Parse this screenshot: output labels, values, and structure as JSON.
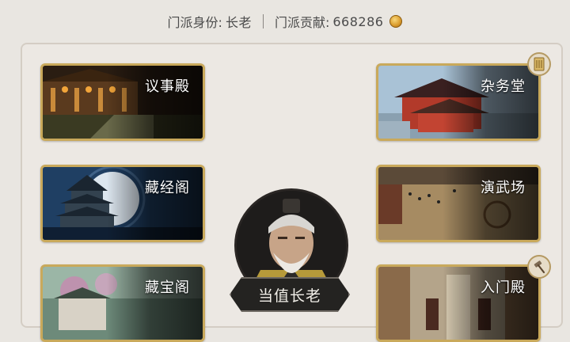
{
  "header": {
    "identity_label": "门派身份:",
    "identity_value": "长老",
    "contribution_label": "门派贡献:",
    "contribution_value": "668286",
    "currency_icon": "gold-coin-icon"
  },
  "halls": {
    "yishi": {
      "label": "议事殿"
    },
    "zawu": {
      "label": "杂务堂",
      "badge_icon": "scroll-icon"
    },
    "cangjing": {
      "label": "藏经阁"
    },
    "yanwu": {
      "label": "演武场"
    },
    "cangbao": {
      "label": "藏宝阁"
    },
    "rumen": {
      "label": "入门殿",
      "badge_icon": "hammer-icon"
    }
  },
  "elder": {
    "button_label": "当值长老",
    "portrait_icon": "elder-portrait"
  },
  "colors": {
    "card_border": "#c9a95b",
    "background": "#e9e6e1",
    "button_bg": "#242321"
  }
}
